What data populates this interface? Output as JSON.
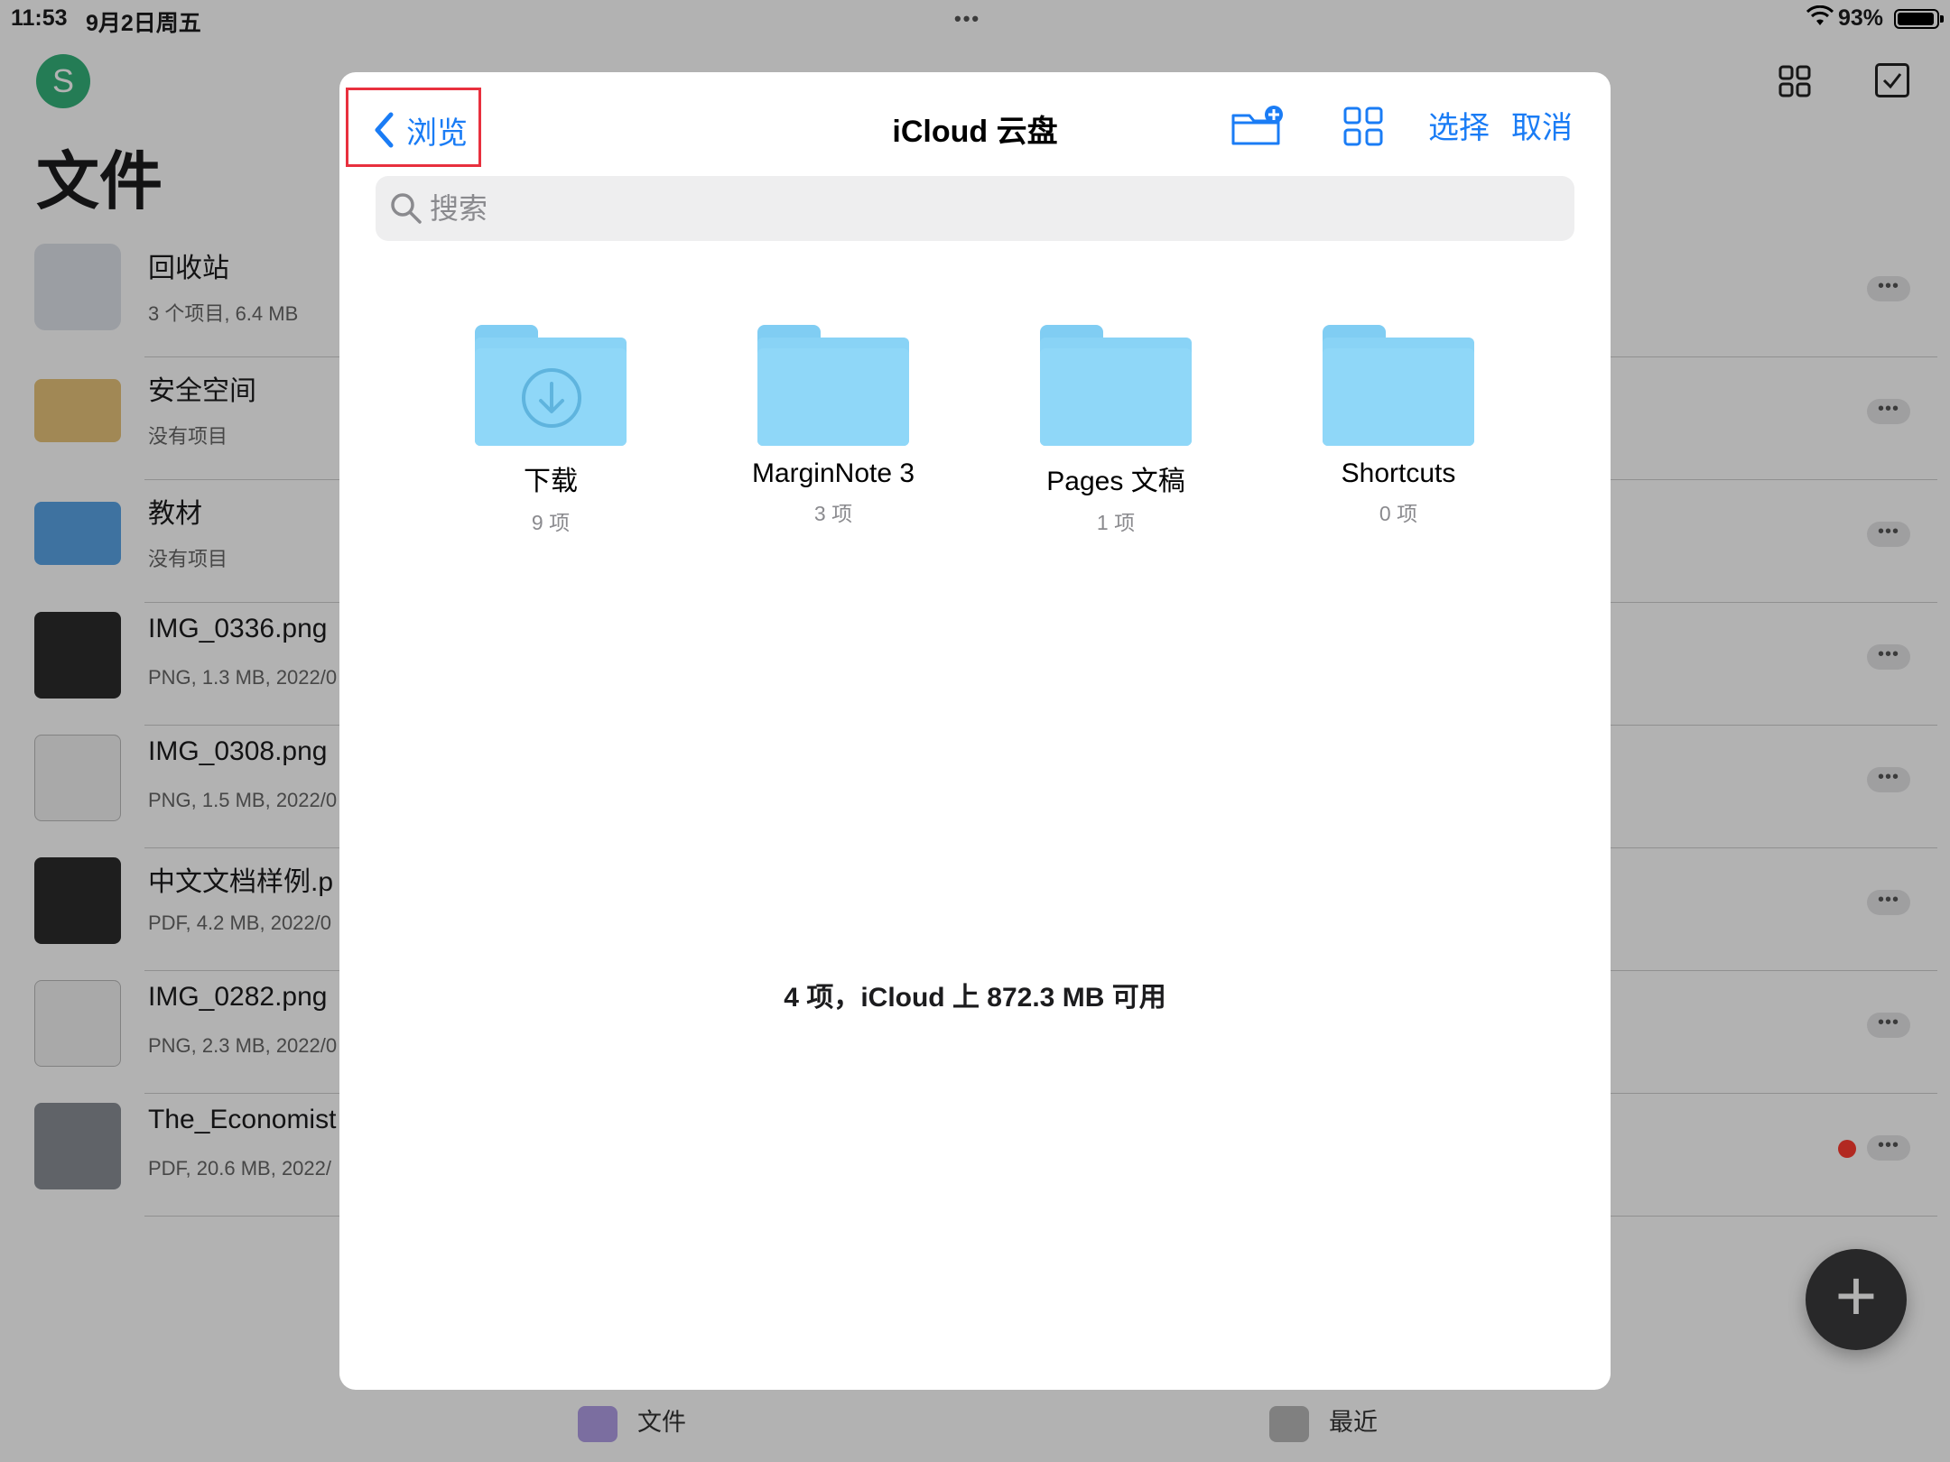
{
  "status_bar": {
    "time": "11:53",
    "date": "9月2日周五",
    "battery": "93%"
  },
  "background": {
    "avatar_letter": "S",
    "title": "文件",
    "items": [
      {
        "name": "回收站",
        "meta": "3 个项目, 6.4 MB",
        "thumb": "trash"
      },
      {
        "name": "安全空间",
        "meta": "没有项目",
        "thumb": "folder-yellow"
      },
      {
        "name": "教材",
        "meta": "没有项目",
        "thumb": "folder-blue"
      },
      {
        "name": "IMG_0336.png",
        "meta": "PNG, 1.3 MB, 2022/0",
        "thumb": "dark"
      },
      {
        "name": "IMG_0308.png",
        "meta": "PNG, 1.5 MB, 2022/0",
        "thumb": "doc"
      },
      {
        "name": "中文文档样例.p",
        "meta": "PDF, 4.2 MB, 2022/0",
        "thumb": "dark"
      },
      {
        "name": "IMG_0282.png",
        "meta": "PNG, 2.3 MB, 2022/0",
        "thumb": "doc"
      },
      {
        "name": "The_Economist",
        "meta": "PDF, 20.6 MB, 2022/",
        "thumb": "watch"
      }
    ],
    "tabs": {
      "files": "文件",
      "recent": "最近"
    }
  },
  "modal": {
    "back_label": "浏览",
    "title": "iCloud 云盘",
    "select_label": "选择",
    "cancel_label": "取消",
    "search_placeholder": "搜索",
    "search_value": "",
    "folders": [
      {
        "name": "下载",
        "count": "9 项",
        "icon": "download-icon"
      },
      {
        "name": "MarginNote 3",
        "count": "3 项"
      },
      {
        "name": "Pages 文稿",
        "count": "1 项"
      },
      {
        "name": "Shortcuts",
        "count": "0 项"
      }
    ],
    "footer": "4 项，iCloud 上 872.3 MB 可用"
  },
  "colors": {
    "accent": "#1a7cf5",
    "highlight": "#e8303e",
    "folder": "#8fd7f8",
    "avatar": "#34b27a"
  }
}
